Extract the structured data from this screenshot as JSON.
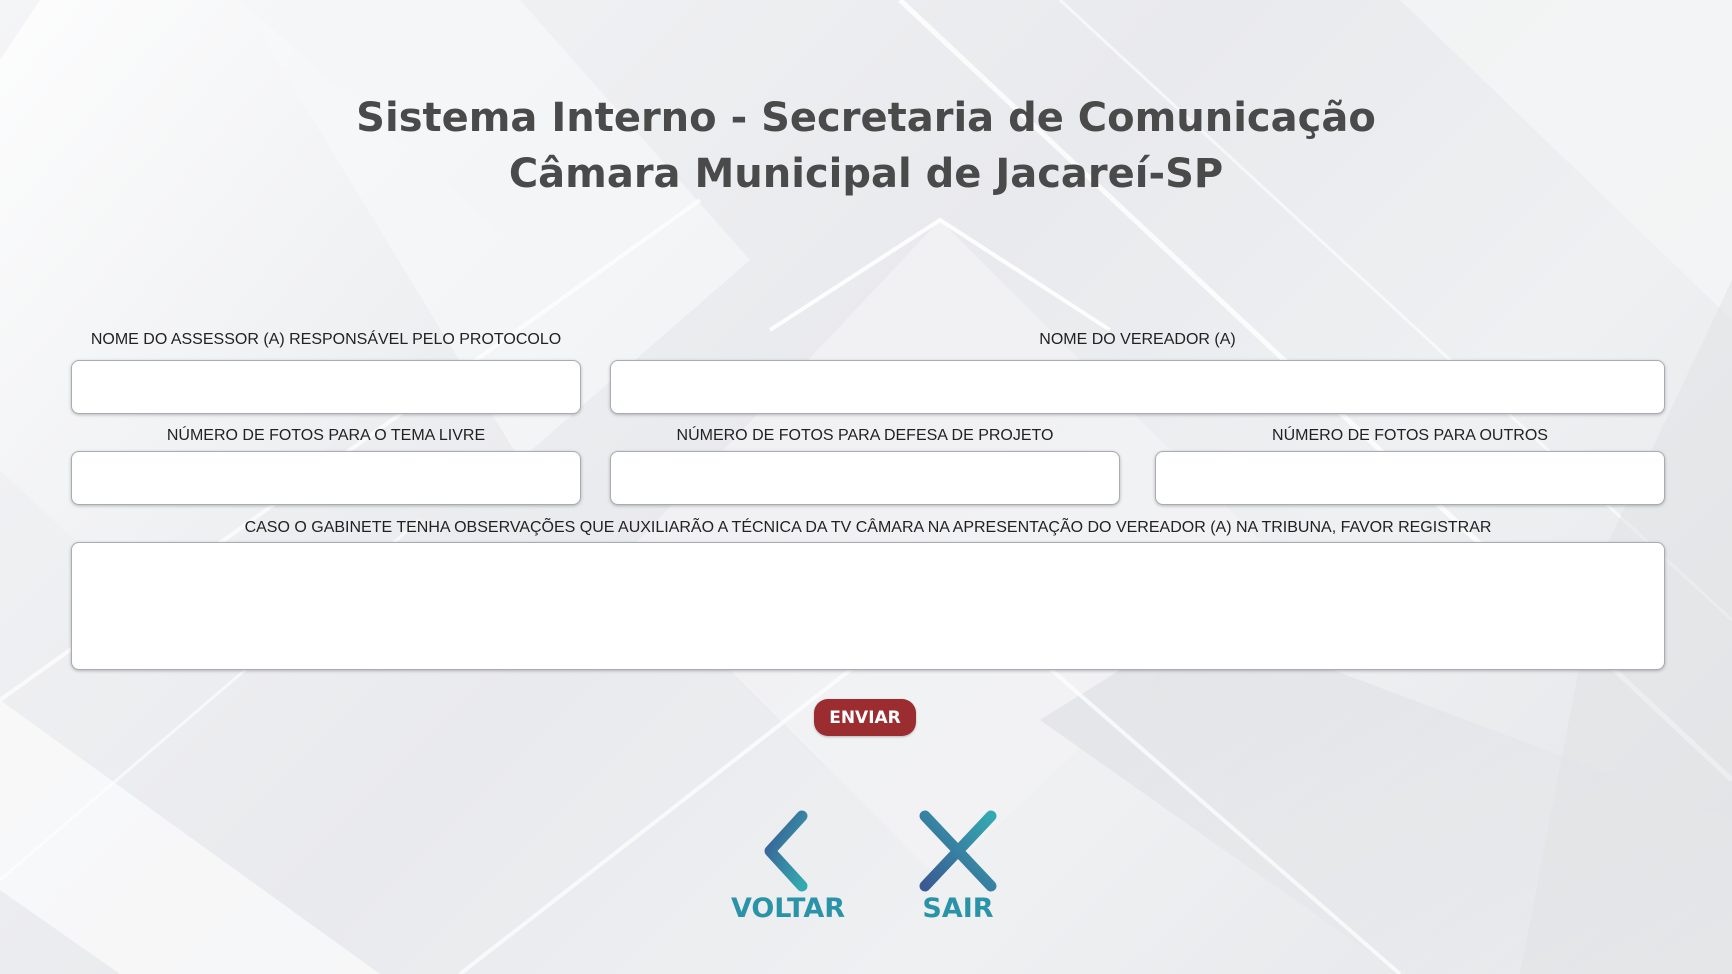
{
  "header": {
    "title_line1": "Sistema Interno - Secretaria de Comunicação",
    "title_line2": "Câmara Municipal de Jacareí-SP"
  },
  "form": {
    "assessor_label": "NOME DO ASSESSOR (A) RESPONSÁVEL PELO PROTOCOLO",
    "assessor_value": "",
    "vereador_label": "NOME DO VEREADOR (A)",
    "vereador_value": "",
    "fotos_tema_livre_label": "NÚMERO DE FOTOS PARA O TEMA LIVRE",
    "fotos_tema_livre_value": "",
    "fotos_defesa_label": "NÚMERO DE FOTOS PARA DEFESA DE PROJETO",
    "fotos_defesa_value": "",
    "fotos_outros_label": "NÚMERO DE FOTOS PARA OUTROS",
    "fotos_outros_value": "",
    "observacoes_label": "CASO O GABINETE TENHA OBSERVAÇÕES QUE AUXILIARÃO A TÉCNICA DA TV CÂMARA NA APRESENTAÇÃO DO VEREADOR (A) NA TRIBUNA, FAVOR REGISTRAR",
    "observacoes_value": "",
    "submit_label": "ENVIAR"
  },
  "nav": {
    "back_label": "VOLTAR",
    "back_icon": "chevron-left-icon",
    "exit_label": "SAIR",
    "exit_icon": "close-icon"
  },
  "colors": {
    "title": "#4a4a4a",
    "submit_bg": "#9b2d30",
    "nav_accent": "#2b93a8",
    "nav_gradient_start": "#3a5a94",
    "nav_gradient_end": "#34a9b0"
  }
}
